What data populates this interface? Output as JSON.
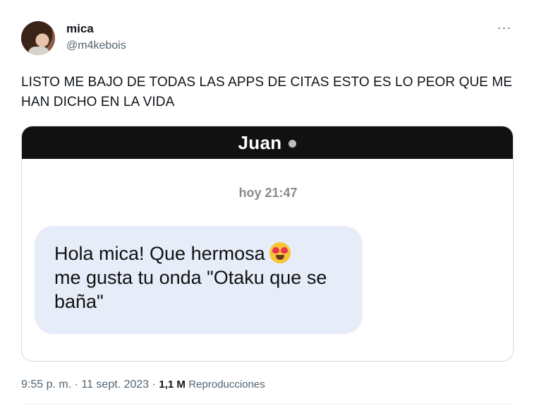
{
  "author": {
    "display_name": "mica",
    "handle": "@m4kebois"
  },
  "more_menu": {
    "glyph": "···"
  },
  "tweet": {
    "text": "LISTO ME BAJO DE TODAS LAS APPS DE CITAS ESTO ES LO PEOR QUE ME HAN DICHO EN LA VIDA"
  },
  "media": {
    "chat_contact": "Juan",
    "online_indicator_color": "#bdbdbd",
    "timestamp": "hoy 21:47",
    "message_text": "Hola mica! Que hermosa",
    "message_rest": "me gusta tu onda \"Otaku que se baña\"",
    "message_emoji": "smiling-face-with-heart-eyes-icon"
  },
  "meta": {
    "time": "9:55 p. m.",
    "separator": " · ",
    "date": "11 sept. 2023",
    "views_count": "1,1 M",
    "views_label": "Reproducciones"
  }
}
